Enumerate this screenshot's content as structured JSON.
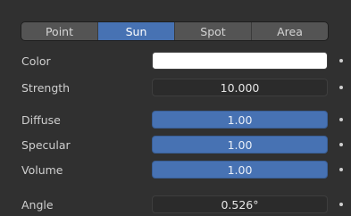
{
  "light_types": {
    "items": [
      {
        "label": "Point"
      },
      {
        "label": "Sun"
      },
      {
        "label": "Spot"
      },
      {
        "label": "Area"
      }
    ],
    "active": "Sun"
  },
  "properties": {
    "color": {
      "label": "Color",
      "value": "#ffffff"
    },
    "strength": {
      "label": "Strength",
      "value": "10.000"
    },
    "diffuse": {
      "label": "Diffuse",
      "value": "1.00"
    },
    "specular": {
      "label": "Specular",
      "value": "1.00"
    },
    "volume": {
      "label": "Volume",
      "value": "1.00"
    },
    "angle": {
      "label": "Angle",
      "value": "0.526°"
    }
  },
  "colors": {
    "background": "#303030",
    "active_accent": "#4772b3",
    "field_dark": "#2b2b2b",
    "button": "#545454"
  }
}
